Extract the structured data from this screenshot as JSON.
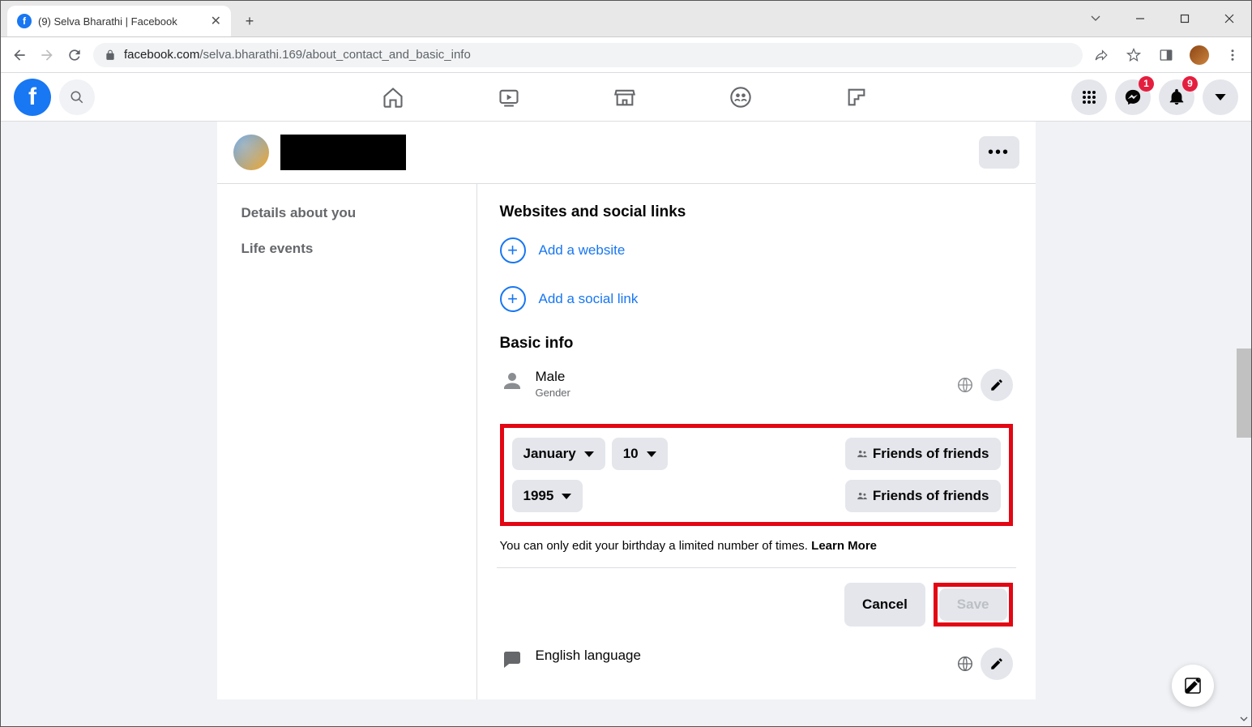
{
  "window": {
    "tab_title": "(9) Selva Bharathi | Facebook"
  },
  "addressbar": {
    "url_prefix": "facebook.com",
    "url_path": "/selva.bharathi.169/about_contact_and_basic_info"
  },
  "fbheader": {
    "messenger_badge": "1",
    "notif_badge": "9"
  },
  "sidebar": {
    "details": "Details about you",
    "lifeevents": "Life events"
  },
  "sections": {
    "websites_title": "Websites and social links",
    "add_website": "Add a website",
    "add_social": "Add a social link",
    "basic_title": "Basic info"
  },
  "gender": {
    "value": "Male",
    "label": "Gender"
  },
  "birthday": {
    "month": "January",
    "day": "10",
    "year": "1995",
    "privacy1": "Friends of friends",
    "privacy2": "Friends of friends",
    "note": "You can only edit your birthday a limited number of times. ",
    "learnmore": "Learn More"
  },
  "buttons": {
    "cancel": "Cancel",
    "save": "Save"
  },
  "lang": {
    "value": "English language"
  }
}
